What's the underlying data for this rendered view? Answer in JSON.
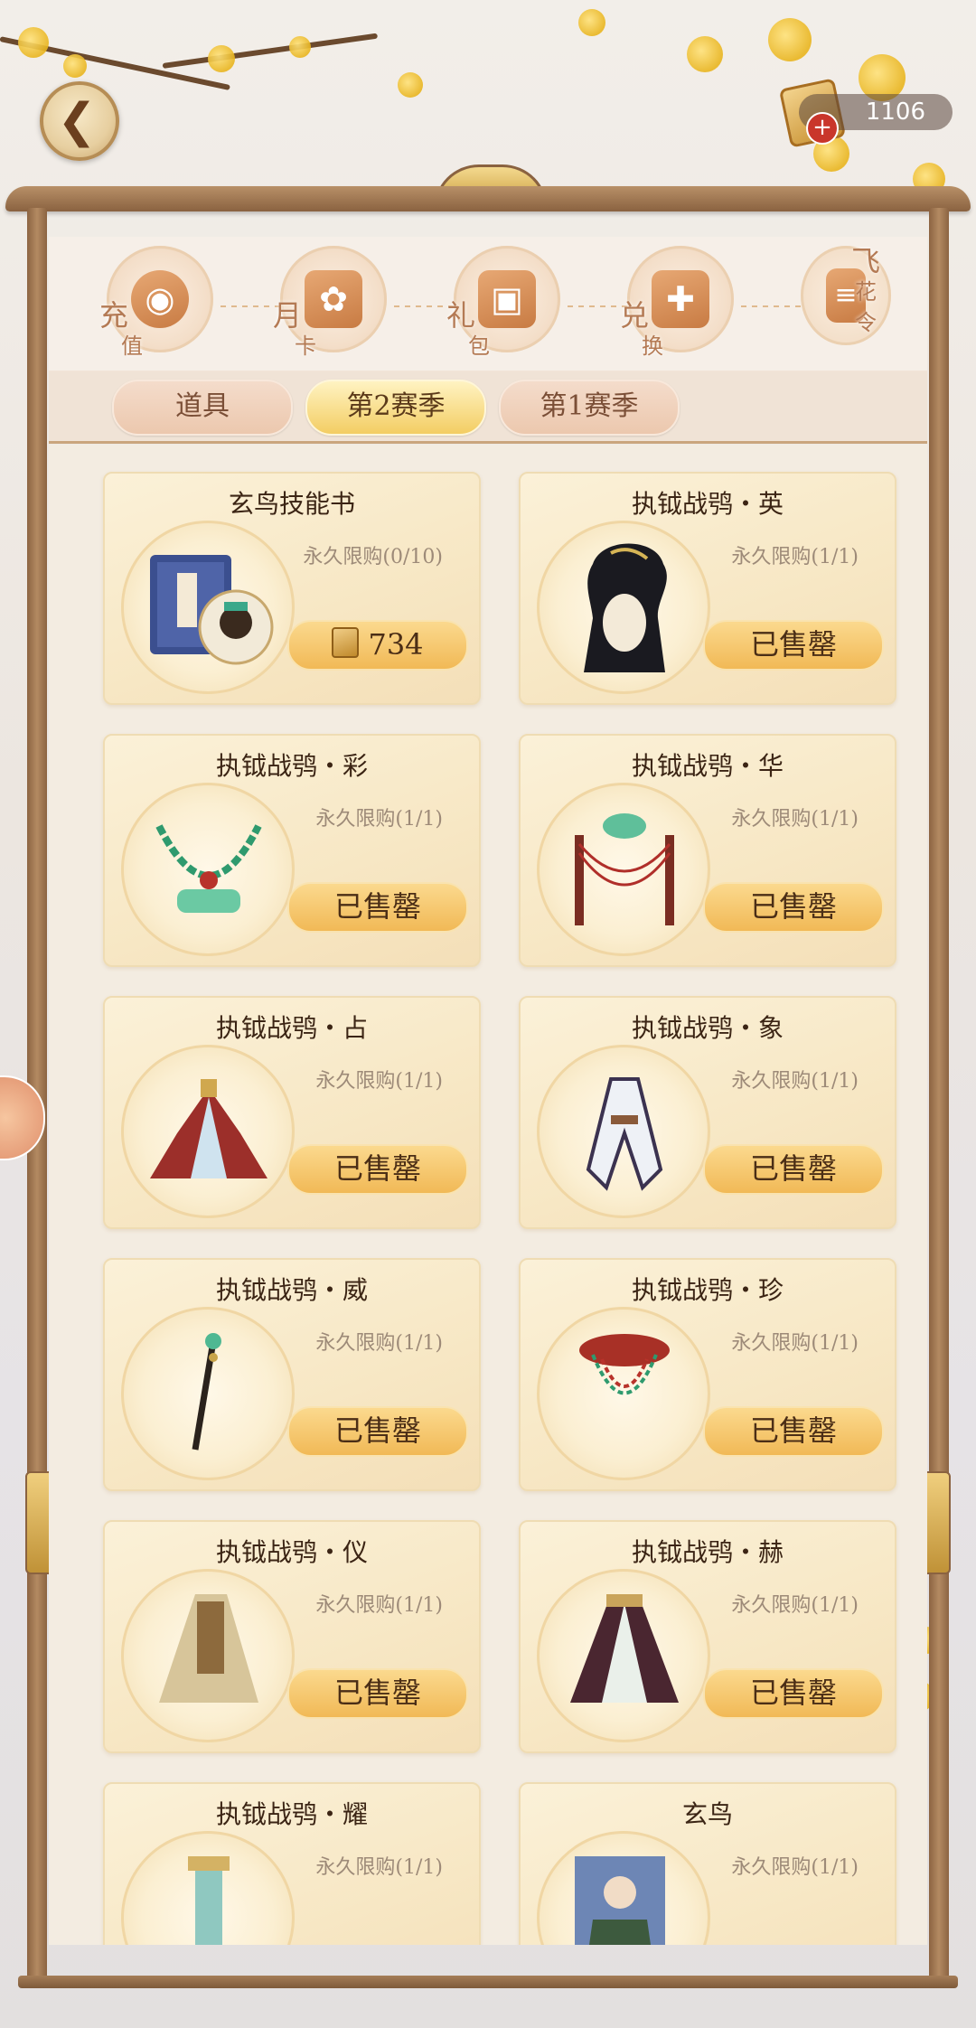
{
  "header": {
    "back_icon": "back-chevron-icon",
    "currency_icon": "scroll-token-icon",
    "currency_amount": "1106",
    "currency_add": "+"
  },
  "categories": [
    {
      "label": "充",
      "sub": "值",
      "icon": "coin-icon",
      "glyph": "◉"
    },
    {
      "label": "月",
      "sub": "卡",
      "icon": "card-flower-icon",
      "glyph": "✿"
    },
    {
      "label": "礼",
      "sub": "包",
      "icon": "gift-box-icon",
      "glyph": "▣"
    },
    {
      "label": "兑",
      "sub": "换",
      "icon": "gift-ribbon-icon",
      "glyph": "✚"
    },
    {
      "label": "飞",
      "sub": "花令",
      "icon": "scroll-icon",
      "glyph": "≡"
    }
  ],
  "tabs": [
    {
      "label": "道具",
      "active": false
    },
    {
      "label": "第2赛季",
      "active": true
    },
    {
      "label": "第1赛季",
      "active": false
    }
  ],
  "items": [
    {
      "name": "玄鸟技能书",
      "limit": "永久限购(0/10)",
      "button": "734",
      "price_icon": "token-icon",
      "art": "book"
    },
    {
      "name": "执钺战鸮・英",
      "limit": "永久限购(1/1)",
      "button": "已售罄",
      "art": "hair"
    },
    {
      "name": "执钺战鸮・彩",
      "limit": "永久限购(1/1)",
      "button": "已售罄",
      "art": "necklace"
    },
    {
      "name": "执钺战鸮・华",
      "limit": "永久限购(1/1)",
      "button": "已售罄",
      "art": "headdress"
    },
    {
      "name": "执钺战鸮・占",
      "limit": "永久限购(1/1)",
      "button": "已售罄",
      "art": "gown-red"
    },
    {
      "name": "执钺战鸮・象",
      "limit": "永久限购(1/1)",
      "button": "已售罄",
      "art": "robe-white"
    },
    {
      "name": "执钺战鸮・威",
      "limit": "永久限购(1/1)",
      "button": "已售罄",
      "art": "staff"
    },
    {
      "name": "执钺战鸮・珍",
      "limit": "永久限购(1/1)",
      "button": "已售罄",
      "art": "crown"
    },
    {
      "name": "执钺战鸮・仪",
      "limit": "永久限购(1/1)",
      "button": "已售罄",
      "art": "cape"
    },
    {
      "name": "执钺战鸮・赫",
      "limit": "永久限购(1/1)",
      "button": "已售罄",
      "art": "skirt"
    },
    {
      "name": "执钺战鸮・耀",
      "limit": "永久限购(1/1)",
      "button": "",
      "art": "pendant"
    },
    {
      "name": "玄鸟",
      "limit": "永久限购(1/1)",
      "button": "",
      "art": "portrait"
    }
  ]
}
